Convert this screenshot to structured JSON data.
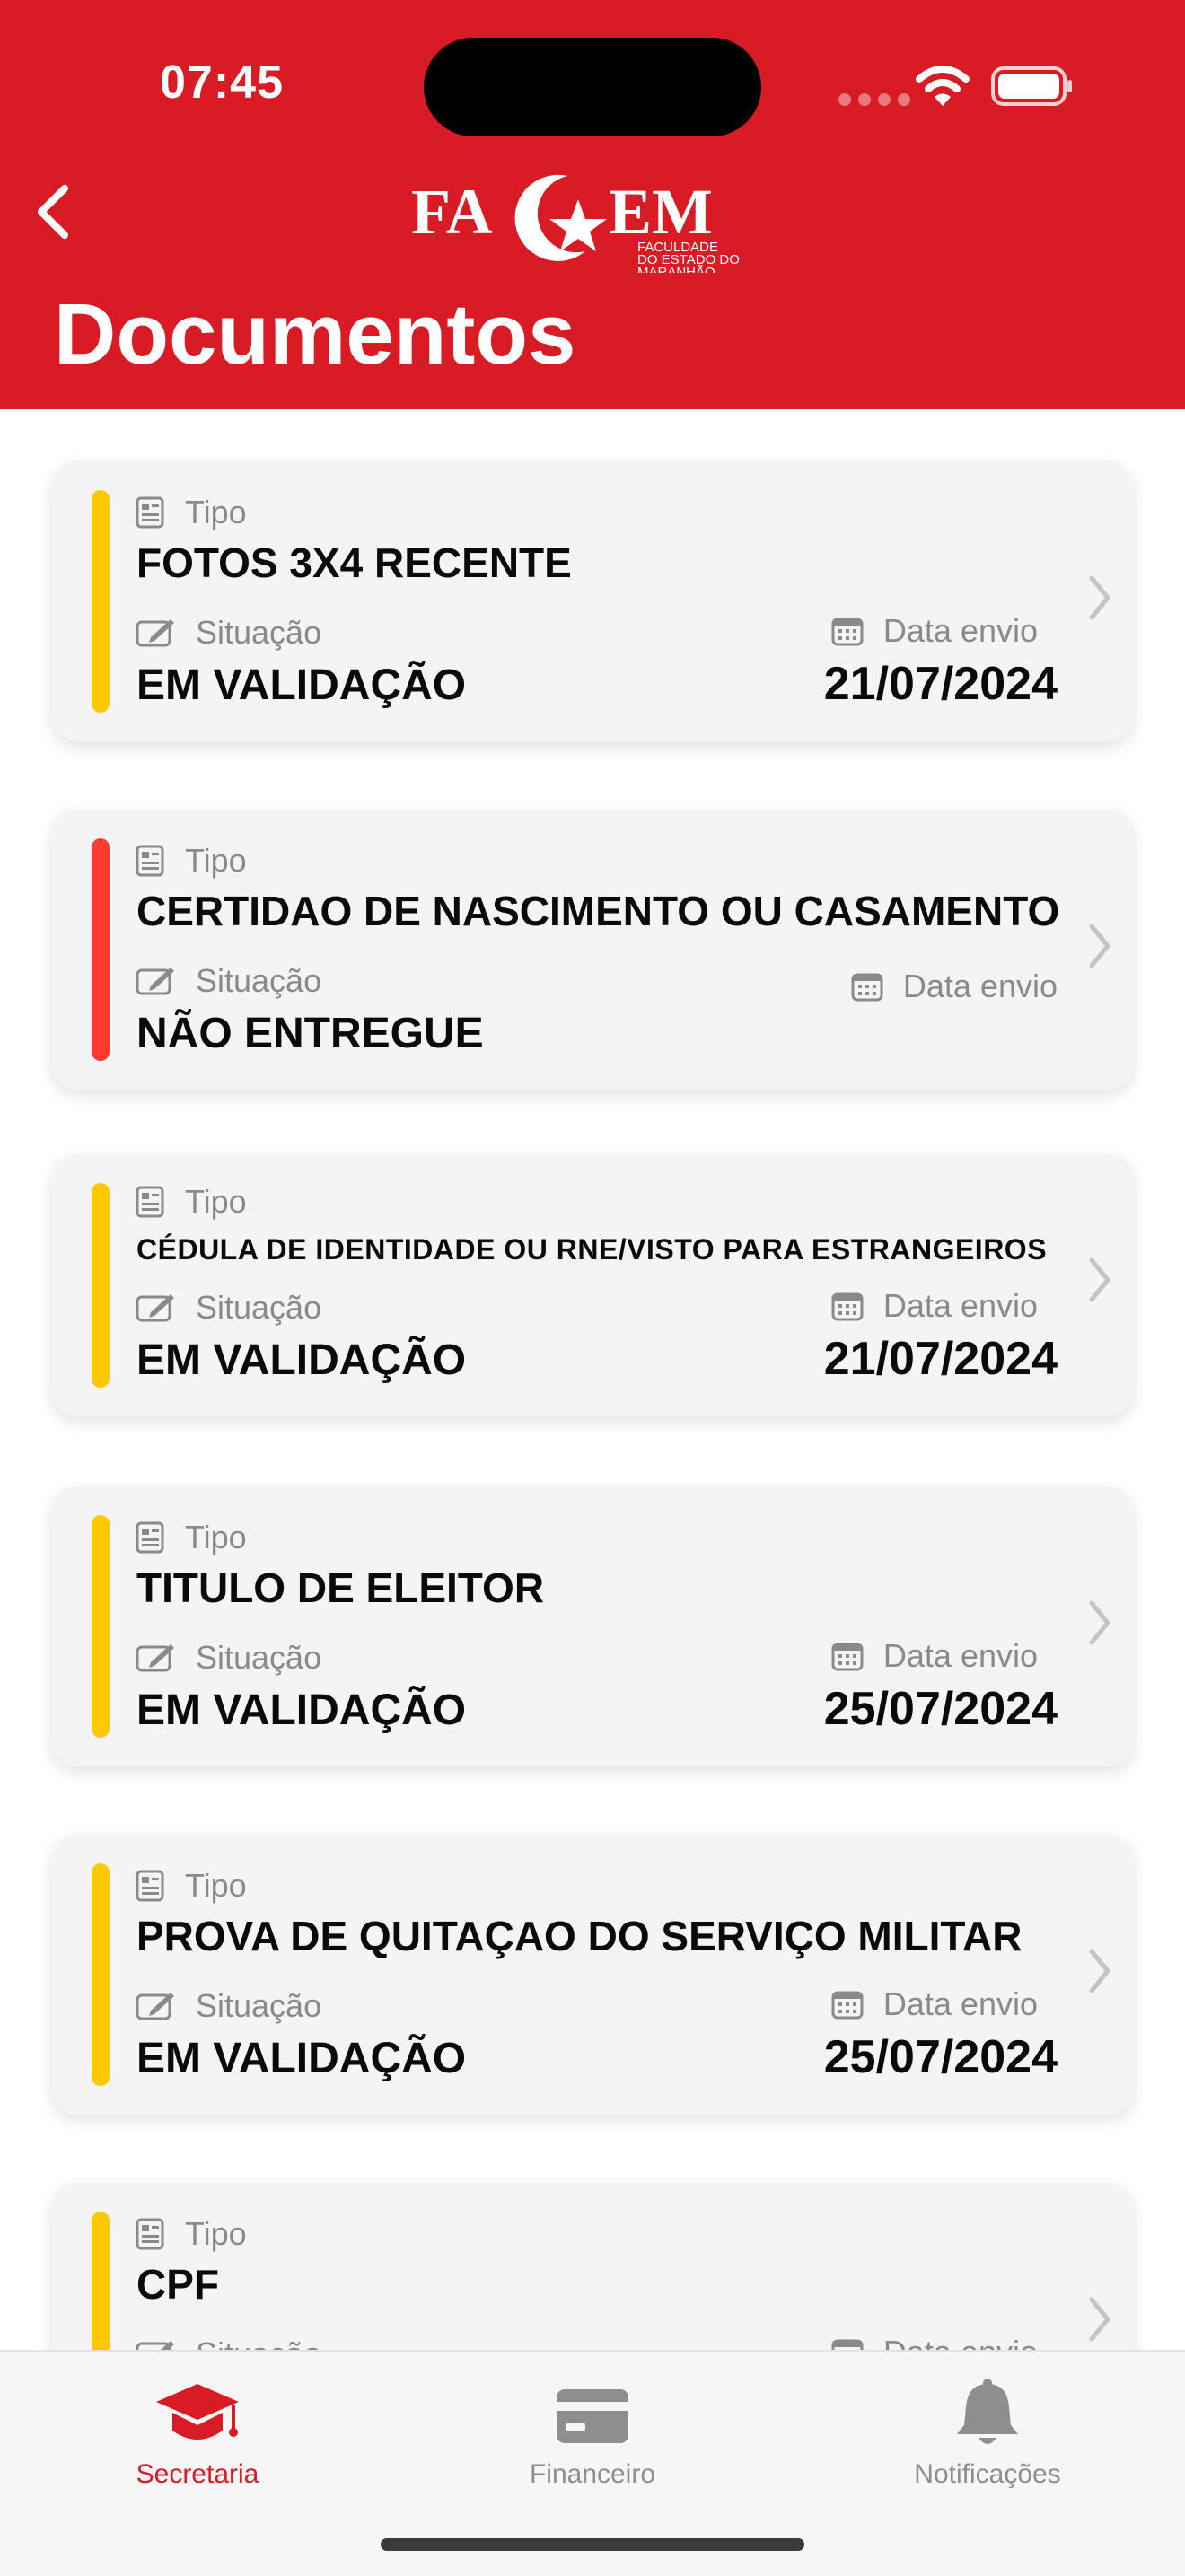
{
  "status": {
    "time": "07:45"
  },
  "header": {
    "logo_text": "FACEM",
    "logo_subtitle": "FACULDADE DO ESTADO DO MARANHÃO",
    "title": "Documentos"
  },
  "labels": {
    "tipo": "Tipo",
    "situacao": "Situação",
    "data_envio": "Data envio"
  },
  "documents": [
    {
      "tipo": "FOTOS 3X4 RECENTE",
      "situacao": "EM VALIDAÇÃO",
      "data": "21/07/2024",
      "status_color": "#FFC800"
    },
    {
      "tipo": "CERTIDAO DE NASCIMENTO OU CASAMENTO",
      "situacao": "NÃO ENTREGUE",
      "data": "",
      "status_color": "#FF3B30"
    },
    {
      "tipo": "CÉDULA DE IDENTIDADE OU RNE/VISTO PARA ESTRANGEIROS",
      "situacao": "EM VALIDAÇÃO",
      "data": "21/07/2024",
      "status_color": "#FFC800"
    },
    {
      "tipo": "TITULO DE ELEITOR",
      "situacao": "EM VALIDAÇÃO",
      "data": "25/07/2024",
      "status_color": "#FFC800"
    },
    {
      "tipo": "PROVA DE QUITAÇAO DO SERVIÇO MILITAR",
      "situacao": "EM VALIDAÇÃO",
      "data": "25/07/2024",
      "status_color": "#FFC800"
    },
    {
      "tipo": "CPF",
      "situacao": "",
      "data": "",
      "status_color": "#FFC800"
    }
  ],
  "tabs": [
    {
      "label": "Secretaria",
      "icon": "graduation-cap-icon",
      "active": true
    },
    {
      "label": "Financeiro",
      "icon": "credit-card-icon",
      "active": false
    },
    {
      "label": "Notificações",
      "icon": "bell-icon",
      "active": false
    }
  ],
  "colors": {
    "brand": "#D81B24",
    "inactive_tab": "#8e8e8e",
    "pending": "#FFC800",
    "missing": "#FF3B30"
  }
}
